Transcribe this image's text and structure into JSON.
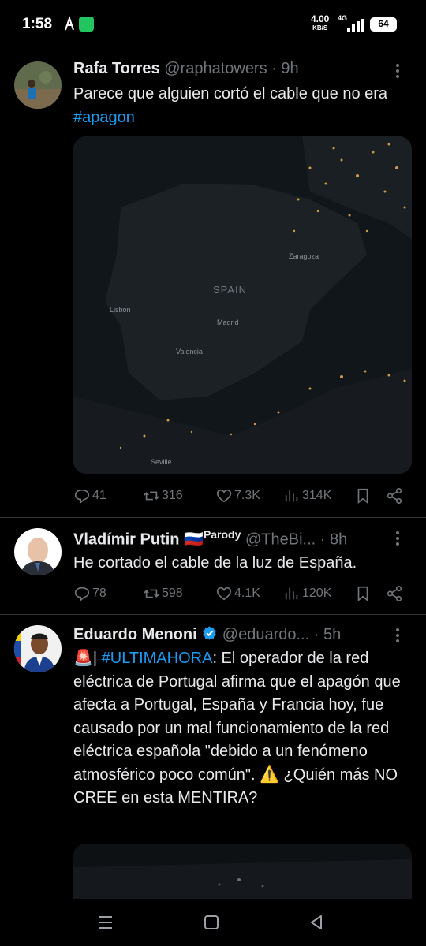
{
  "status": {
    "time": "1:58",
    "speed_value": "4.00",
    "speed_unit": "KB/S",
    "network": "4G",
    "battery": "64"
  },
  "tweets": [
    {
      "name": "Rafa Torres",
      "handle": "@raphatowers",
      "dot": "·",
      "time": "9h",
      "text": "Parece que alguien cortó el cable que no era ",
      "hashtag": "#apagon",
      "media": {
        "labels": {
          "spain": "SPAIN",
          "zaragoza": "Zaragoza",
          "lisbon": "Lisbon",
          "madrid": "Madrid",
          "valencia": "Valencia",
          "seville": "Seville"
        }
      },
      "replies": "41",
      "reposts": "316",
      "likes": "7.3K",
      "views": "314K"
    },
    {
      "name": "Vladímir Putin",
      "flag": "🇷🇺",
      "label": "Parody",
      "handle": "@TheBi...",
      "dot": "·",
      "time": "8h",
      "text": "He cortado el cable de la luz de España.",
      "replies": "78",
      "reposts": "598",
      "likes": "4.1K",
      "views": "120K"
    },
    {
      "name": "Eduardo Menoni",
      "handle": "@eduardo...",
      "dot": "·",
      "time": "5h",
      "emoji_siren": "🚨",
      "bar": "|",
      "hashtag": "#ULTIMAHORA",
      "text": ": El operador de la red eléctrica de Portugal afirma que el apagón que afecta a Portugal, España y Francia hoy, fue causado por un mal funcionamiento de la red eléctrica española \"debido a un fenómeno atmosférico poco común\". ",
      "emoji_warning": "⚠️",
      "text_end": " ¿Quién más NO CREE en esta MENTIRA?"
    }
  ],
  "colors": {
    "background": "#000000",
    "text": "#e7e9ea",
    "muted": "#71767b",
    "link": "#1d9bf0",
    "verified": "#1d9bf0",
    "divider": "#2f3336"
  },
  "icons": [
    "reply-icon",
    "repost-icon",
    "like-icon",
    "views-icon",
    "bookmark-icon",
    "share-icon",
    "more-icon",
    "verified-icon"
  ]
}
